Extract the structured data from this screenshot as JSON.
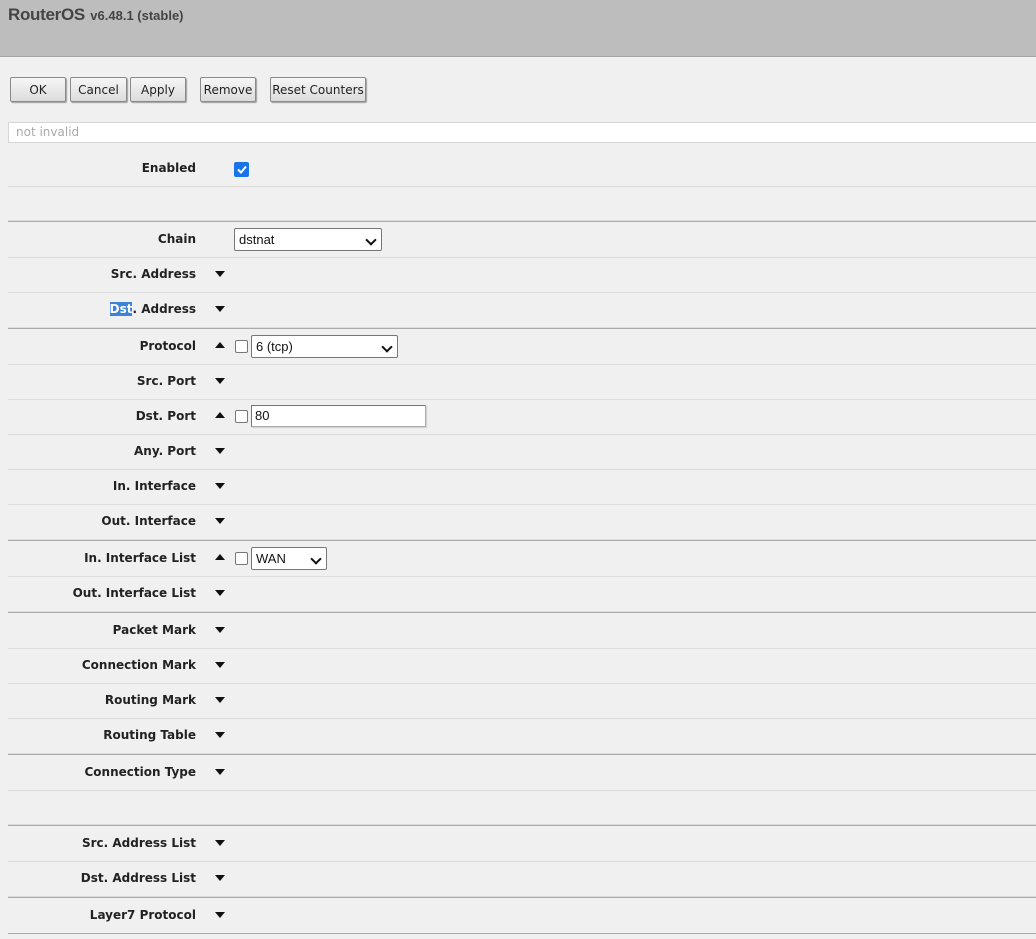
{
  "app": {
    "name": "RouterOS",
    "version": "v6.48.1 (stable)"
  },
  "toolbar": {
    "ok": "OK",
    "cancel": "Cancel",
    "apply": "Apply",
    "remove": "Remove",
    "reset_counters": "Reset Counters"
  },
  "status_text": "not invalid",
  "fields": {
    "enabled": {
      "label": "Enabled",
      "checked": true
    },
    "chain": {
      "label": "Chain",
      "value": "dstnat"
    },
    "src_address": {
      "label": "Src. Address"
    },
    "dst_address": {
      "label_highlight": "Dst",
      "label_rest": ". Address"
    },
    "protocol": {
      "label": "Protocol",
      "value": "6 (tcp)"
    },
    "src_port": {
      "label": "Src. Port"
    },
    "dst_port": {
      "label": "Dst. Port",
      "value": "80"
    },
    "any_port": {
      "label": "Any. Port"
    },
    "in_interface": {
      "label": "In. Interface"
    },
    "out_interface": {
      "label": "Out. Interface"
    },
    "in_interface_list": {
      "label": "In. Interface List",
      "value": "WAN"
    },
    "out_interface_list": {
      "label": "Out. Interface List"
    },
    "packet_mark": {
      "label": "Packet Mark"
    },
    "connection_mark": {
      "label": "Connection Mark"
    },
    "routing_mark": {
      "label": "Routing Mark"
    },
    "routing_table": {
      "label": "Routing Table"
    },
    "connection_type": {
      "label": "Connection Type"
    },
    "src_address_list": {
      "label": "Src. Address List"
    },
    "dst_address_list": {
      "label": "Dst. Address List"
    },
    "layer7_protocol": {
      "label": "Layer7 Protocol"
    }
  },
  "colors": {
    "header_bg": "#bdbdbd",
    "page_bg": "#f0f0f0",
    "accent": "#1a73e8"
  }
}
